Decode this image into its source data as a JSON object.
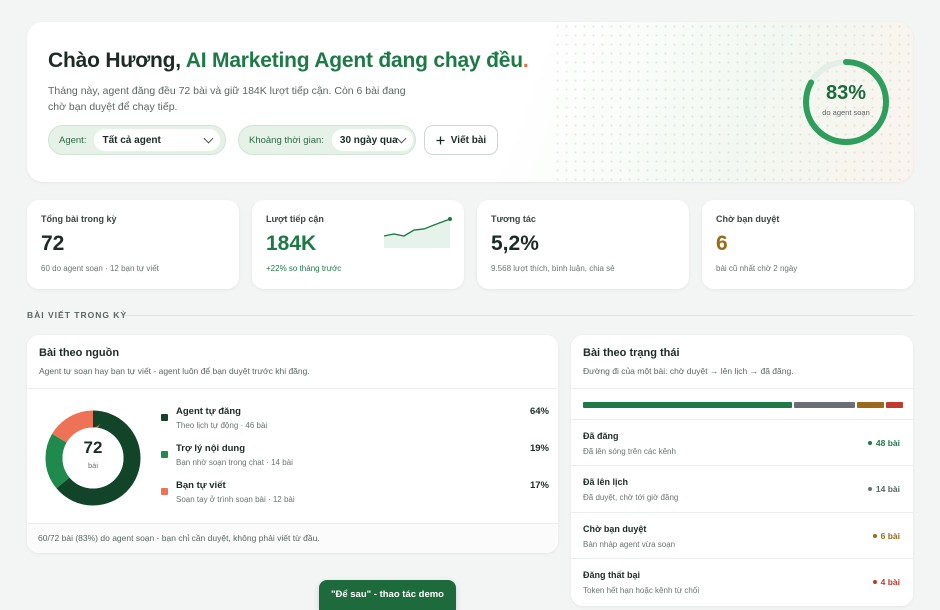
{
  "hero": {
    "greeting": "Chào Hương,",
    "title_accent": "AI Marketing Agent đang chạy đều",
    "title_dot": ".",
    "subtitle": "Tháng này, agent đăng đều 72 bài và giữ 184K lượt tiếp cận. Còn 6 bài đang chờ bạn duyệt để chạy tiếp.",
    "filters": [
      {
        "label": "Agent:",
        "value": "Tất cả agent"
      },
      {
        "label": "Khoảng thời gian:",
        "value": "30 ngày qua"
      }
    ],
    "write_button": "Viết bài",
    "ring": {
      "value": "83%",
      "label": "do agent soạn",
      "fraction": 0.83
    }
  },
  "kpis": [
    {
      "label": "Tổng bài trong kỳ",
      "value": "72",
      "sub": "60 do agent soạn · 12 bạn tự viết"
    },
    {
      "label": "Lượt tiếp cận",
      "value": "184K",
      "sub": "+22% so tháng trước"
    },
    {
      "label": "Tương tác",
      "value": "5,2%",
      "sub": "9.568 lượt thích, bình luận, chia sẻ"
    },
    {
      "label": "Chờ bạn duyệt",
      "value": "6",
      "sub": "bài cũ nhất chờ 2 ngày"
    }
  ],
  "section_label": "BÀI VIẾT TRONG KỲ",
  "by_source": {
    "title": "Bài theo nguồn",
    "subtitle": "Agent tự soạn hay bạn tự viết - agent luôn để bạn duyệt trước khi đăng.",
    "total": "72",
    "total_label": "bài",
    "items": [
      {
        "name": "Agent tự đăng",
        "sub": "Theo lịch tự động · 46 bài",
        "pct": "64%",
        "value": 46,
        "color": "#12442a"
      },
      {
        "name": "Trợ lý nội dung",
        "sub": "Bạn nhờ soạn trong chat · 14 bài",
        "pct": "19%",
        "value": 14,
        "color": "#1f8a4c"
      },
      {
        "name": "Bạn tự viết",
        "sub": "Soạn tay ở trình soạn bài · 12 bài",
        "pct": "17%",
        "value": 12,
        "color": "#ee7356"
      }
    ],
    "footer": "60/72 bài (83%) do agent soạn - bạn chỉ cần duyệt, không phải viết từ đầu."
  },
  "by_status": {
    "title": "Bài theo trạng thái",
    "subtitle": "Đường đi của một bài: chờ duyệt → lên lịch → đã đăng.",
    "rows": [
      {
        "name": "Đã đăng",
        "sub": "Đã lên sóng trên các kênh",
        "count": "48 bài",
        "value": 48,
        "color": "#1d7a46"
      },
      {
        "name": "Đã lên lịch",
        "sub": "Đã duyệt, chờ tới giờ đăng",
        "count": "14 bài",
        "value": 14,
        "color": "#6b6f73"
      },
      {
        "name": "Chờ bạn duyệt",
        "sub": "Bản nháp agent vừa soạn",
        "count": "6 bài",
        "value": 6,
        "color": "#9a6a1a"
      },
      {
        "name": "Đăng thất bại",
        "sub": "Token hết hạn hoặc kênh từ chối",
        "count": "4 bài",
        "value": 4,
        "color": "#c0392b"
      }
    ]
  },
  "toast": "\"Để sau\" - thao tác demo",
  "colors": {
    "accent": "#1d7a46",
    "dark_green": "#12442a",
    "coral": "#ee7356",
    "brown": "#9a6a1a"
  }
}
